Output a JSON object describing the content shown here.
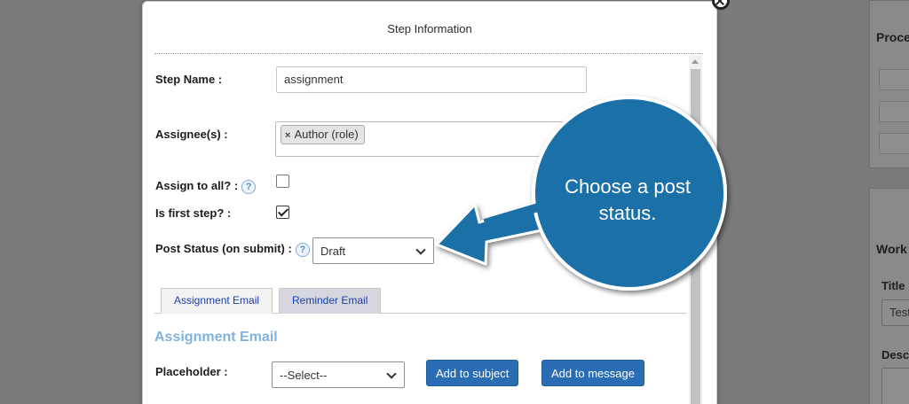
{
  "background": {
    "heading_top": "Proce",
    "heading_bottom": "Work",
    "title_label": "Title",
    "title_value": "Test",
    "desc_label": "Desc"
  },
  "modal": {
    "title": "Step Information",
    "step_name_label": "Step Name :",
    "step_name_value": "assignment",
    "assignees_label": "Assignee(s) :",
    "assignee_tag": "Author (role)",
    "assign_all_label": "Assign to all? :",
    "assign_all_checked": false,
    "first_step_label": "Is first step? :",
    "first_step_checked": true,
    "post_status_label": "Post Status (on submit) :",
    "post_status_value": "Draft",
    "help_glyph": "?",
    "tabs": [
      {
        "label": "Assignment Email",
        "active": true
      },
      {
        "label": "Reminder Email",
        "active": false
      }
    ],
    "section_title": "Assignment Email",
    "placeholder_label": "Placeholder :",
    "placeholder_value": "--Select--",
    "add_subject_label": "Add to subject",
    "add_message_label": "Add to message"
  },
  "callout": {
    "text": "Choose a post status.",
    "fill_color": "#1b6fa8",
    "outline_color": "#ffffff"
  }
}
